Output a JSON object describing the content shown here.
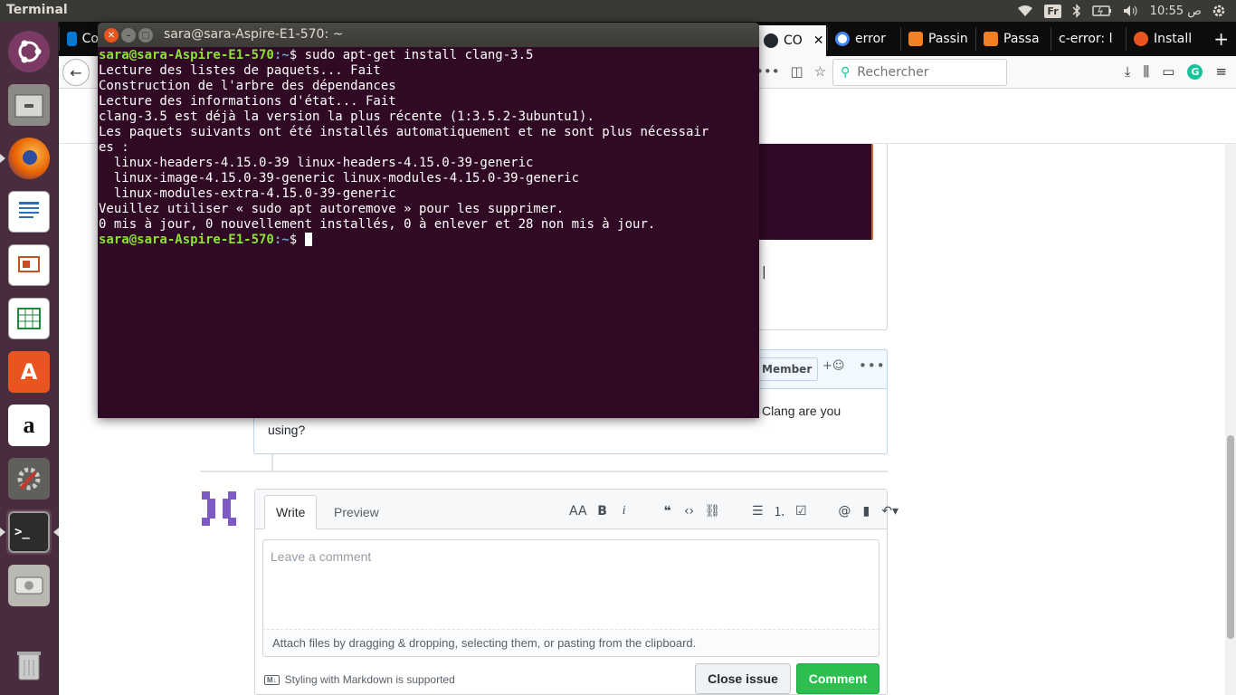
{
  "top_panel": {
    "app_title": "Terminal",
    "keyboard_layout": "Fr",
    "clock": "10:55 ص"
  },
  "launcher": {
    "items": [
      {
        "name": "ubuntu-dash"
      },
      {
        "name": "files"
      },
      {
        "name": "firefox"
      },
      {
        "name": "libreoffice-writer"
      },
      {
        "name": "libreoffice-impress"
      },
      {
        "name": "libreoffice-calc"
      },
      {
        "name": "ubuntu-software"
      },
      {
        "name": "amazon"
      },
      {
        "name": "system-settings"
      },
      {
        "name": "terminal"
      },
      {
        "name": "disk"
      },
      {
        "name": "trash"
      }
    ]
  },
  "browser": {
    "tabs": [
      {
        "label": "Co",
        "color": "#0078d4"
      },
      {
        "label": "CO",
        "color": "#24292e"
      },
      {
        "label": "error",
        "color": "#4285f4"
      },
      {
        "label": "Passin",
        "color": "#f48024"
      },
      {
        "label": "Passa",
        "color": "#f48024"
      },
      {
        "label": "c-error: l",
        "color": "#f9f9fa"
      },
      {
        "label": "Install",
        "color": "#e95420"
      }
    ],
    "search_placeholder": "Rechercher",
    "comment2_text_tail": "Clang are you",
    "comment2_text_line2": "using?",
    "member_badge": "Member",
    "composer": {
      "tab_write": "Write",
      "tab_preview": "Preview",
      "placeholder": "Leave a comment",
      "attach_text": "Attach files by dragging & dropping, selecting them, or pasting from the clipboard.",
      "markdown_note": "Styling with Markdown is supported",
      "close_issue": "Close issue",
      "comment": "Comment"
    }
  },
  "terminal": {
    "title": "sara@sara-Aspire-E1-570: ~",
    "prompt_user": "sara@sara-Aspire-E1-570",
    "prompt_path": ":~",
    "command": "$ sudo apt-get install clang-3.5",
    "output": [
      "Lecture des listes de paquets... Fait",
      "Construction de l'arbre des dépendances",
      "Lecture des informations d'état... Fait",
      "clang-3.5 est déjà la version la plus récente (1:3.5.2-3ubuntu1).",
      "Les paquets suivants ont été installés automatiquement et ne sont plus nécessair",
      "es :",
      "  linux-headers-4.15.0-39 linux-headers-4.15.0-39-generic",
      "  linux-image-4.15.0-39-generic linux-modules-4.15.0-39-generic",
      "  linux-modules-extra-4.15.0-39-generic",
      "Veuillez utiliser « sudo apt autoremove » pour les supprimer.",
      "0 mis à jour, 0 nouvellement installés, 0 à enlever et 28 non mis à jour."
    ],
    "final_prompt_suffix": "$ "
  }
}
